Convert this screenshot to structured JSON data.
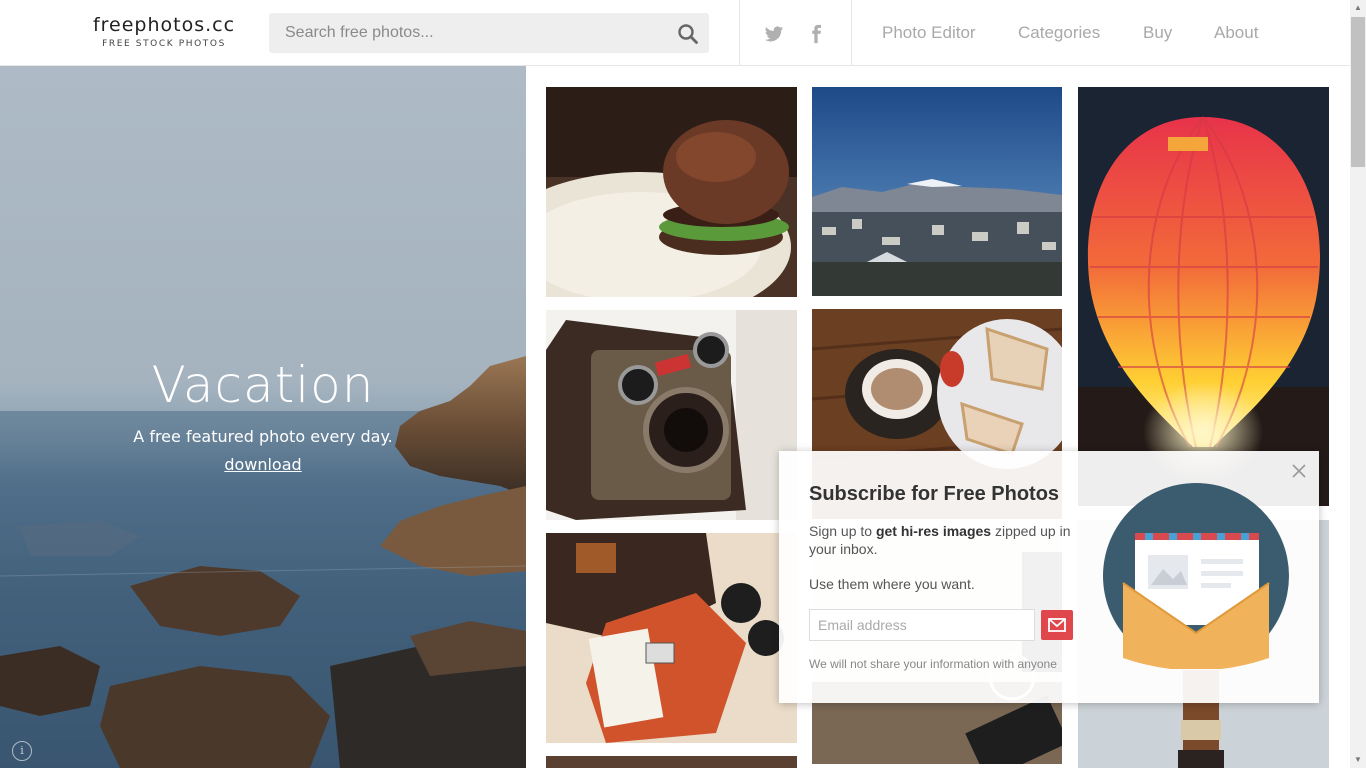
{
  "header": {
    "logo_title": "freephotos.cc",
    "logo_subtitle": "FREE STOCK PHOTOS",
    "search_placeholder": "Search free photos...",
    "social": [
      "twitter-icon",
      "facebook-icon"
    ],
    "nav": [
      "Photo Editor",
      "Categories",
      "Buy",
      "About"
    ]
  },
  "hero": {
    "title": "Vacation",
    "tagline": "A free featured photo every day.",
    "download": "download"
  },
  "grid": {
    "photos": [
      "burger",
      "city-mountains",
      "balloon",
      "camera",
      "coffee-toast",
      "bag-sunglasses",
      "desk",
      "wood-handle"
    ]
  },
  "popup": {
    "title": "Subscribe for Free Photos",
    "p1_pre": "Sign up to ",
    "p1_bold": "get hi-res images",
    "p1_post": " zipped up in your inbox.",
    "p2": "Use them where you want.",
    "email_placeholder": "Email address",
    "note": "We will not share your information with anyone"
  },
  "colors": {
    "accent": "#e0474c",
    "nav": "#a9a9a9",
    "illus_circle": "#3b5c6e",
    "envelope": "#f0b25a"
  }
}
